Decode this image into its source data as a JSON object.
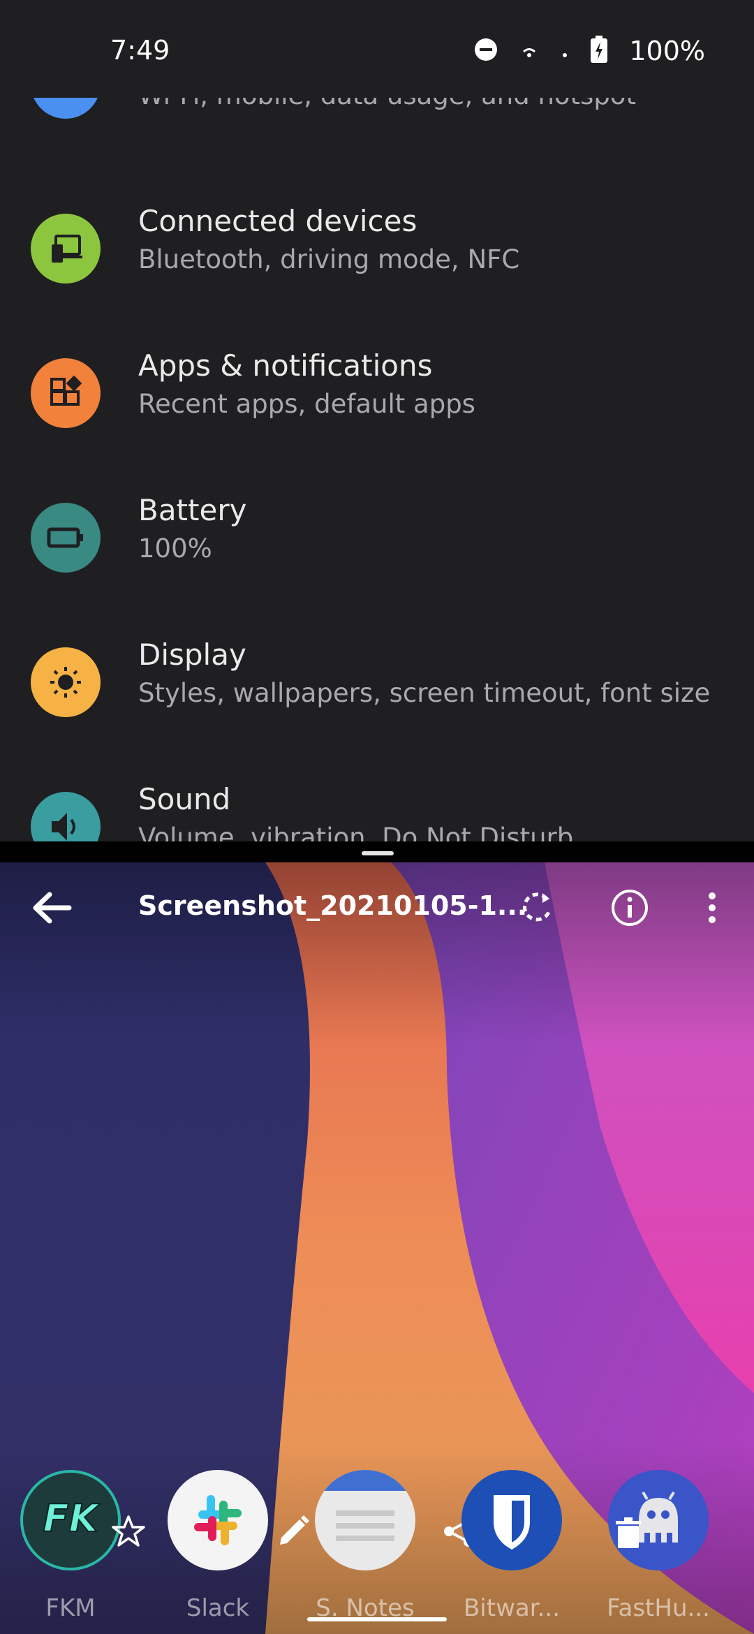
{
  "status_bar": {
    "time": "7:49",
    "battery": "100%",
    "icons": [
      "do-not-disturb-icon",
      "wifi-icon",
      "signal-icon",
      "battery-charging-icon"
    ]
  },
  "settings": {
    "items": [
      {
        "title": "",
        "subtitle": "Wi-Fi, mobile, data usage, and hotspot",
        "icon": "wifi-icon",
        "color": "#4a90f0"
      },
      {
        "title": "Connected devices",
        "subtitle": "Bluetooth, driving mode, NFC",
        "icon": "devices-icon",
        "color": "#8cc63f"
      },
      {
        "title": "Apps & notifications",
        "subtitle": "Recent apps, default apps",
        "icon": "apps-icon",
        "color": "#f2813b"
      },
      {
        "title": "Battery",
        "subtitle": "100%",
        "icon": "battery-icon",
        "color": "#3a8a84"
      },
      {
        "title": "Display",
        "subtitle": "Styles, wallpapers, screen timeout, font size",
        "icon": "brightness-icon",
        "color": "#f6b245"
      },
      {
        "title": "Sound",
        "subtitle": "Volume, vibration, Do Not Disturb",
        "icon": "volume-icon",
        "color": "#3a9da0"
      }
    ]
  },
  "viewer": {
    "title": "Screenshot_20210105-1...",
    "toolbar_icons": [
      "back-arrow-icon",
      "rotate-icon",
      "info-icon",
      "more-vert-icon"
    ]
  },
  "dock": {
    "apps": [
      {
        "label": "FKM",
        "icon": "fkm-icon"
      },
      {
        "label": "Slack",
        "icon": "slack-icon"
      },
      {
        "label": "S. Notes",
        "icon": "notes-icon"
      },
      {
        "label": "Bitwar...",
        "icon": "bitwarden-icon"
      },
      {
        "label": "FastHu...",
        "icon": "fasthub-icon"
      }
    ],
    "actions": [
      "star-icon",
      "edit-icon",
      "share-icon",
      "delete-icon"
    ]
  },
  "colors": {
    "settings_bg": "#1f1f21",
    "wifi": "#4a90f0",
    "devices": "#8cc63f",
    "apps": "#f2813b",
    "battery": "#3a8a84",
    "display": "#f6b245",
    "sound": "#3a9da0"
  }
}
